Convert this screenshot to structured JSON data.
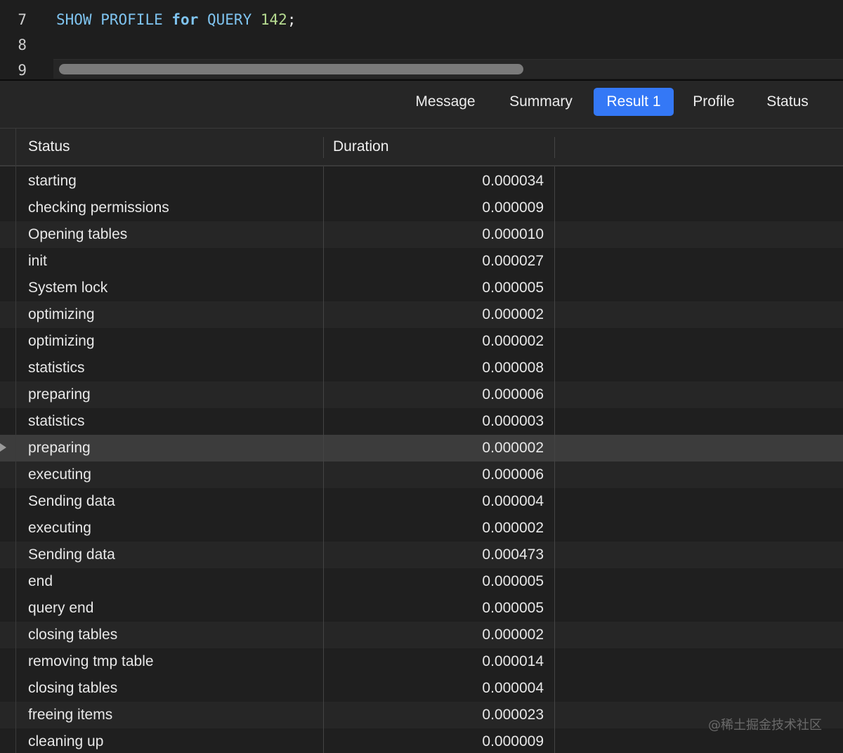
{
  "editor": {
    "line_numbers": [
      "7",
      "8",
      "9"
    ],
    "code": {
      "show": "SHOW",
      "profile": "PROFILE",
      "for": "for",
      "query": "QUERY",
      "number": "142",
      "terminator": ";"
    }
  },
  "tabs": [
    {
      "label": "Message",
      "active": false
    },
    {
      "label": "Summary",
      "active": false
    },
    {
      "label": "Result 1",
      "active": true
    },
    {
      "label": "Profile",
      "active": false
    },
    {
      "label": "Status",
      "active": false
    }
  ],
  "grid": {
    "columns": [
      "Status",
      "Duration"
    ],
    "selected_row_index": 10,
    "rows": [
      {
        "status": "starting",
        "duration": "0.000034"
      },
      {
        "status": "checking permissions",
        "duration": "0.000009"
      },
      {
        "status": "Opening tables",
        "duration": "0.000010"
      },
      {
        "status": "init",
        "duration": "0.000027"
      },
      {
        "status": "System lock",
        "duration": "0.000005"
      },
      {
        "status": "optimizing",
        "duration": "0.000002"
      },
      {
        "status": "optimizing",
        "duration": "0.000002"
      },
      {
        "status": "statistics",
        "duration": "0.000008"
      },
      {
        "status": "preparing",
        "duration": "0.000006"
      },
      {
        "status": "statistics",
        "duration": "0.000003"
      },
      {
        "status": "preparing",
        "duration": "0.000002"
      },
      {
        "status": "executing",
        "duration": "0.000006"
      },
      {
        "status": "Sending data",
        "duration": "0.000004"
      },
      {
        "status": "executing",
        "duration": "0.000002"
      },
      {
        "status": "Sending data",
        "duration": "0.000473"
      },
      {
        "status": "end",
        "duration": "0.000005"
      },
      {
        "status": "query end",
        "duration": "0.000005"
      },
      {
        "status": "closing tables",
        "duration": "0.000002"
      },
      {
        "status": "removing tmp table",
        "duration": "0.000014"
      },
      {
        "status": "closing tables",
        "duration": "0.000004"
      },
      {
        "status": "freeing items",
        "duration": "0.000023"
      },
      {
        "status": "cleaning up",
        "duration": "0.000009"
      }
    ]
  },
  "watermark": "@稀土掘金技术社区",
  "colors": {
    "active_tab": "#3478f6",
    "keyword": "#7fc4f0",
    "number": "#b7dc91"
  }
}
